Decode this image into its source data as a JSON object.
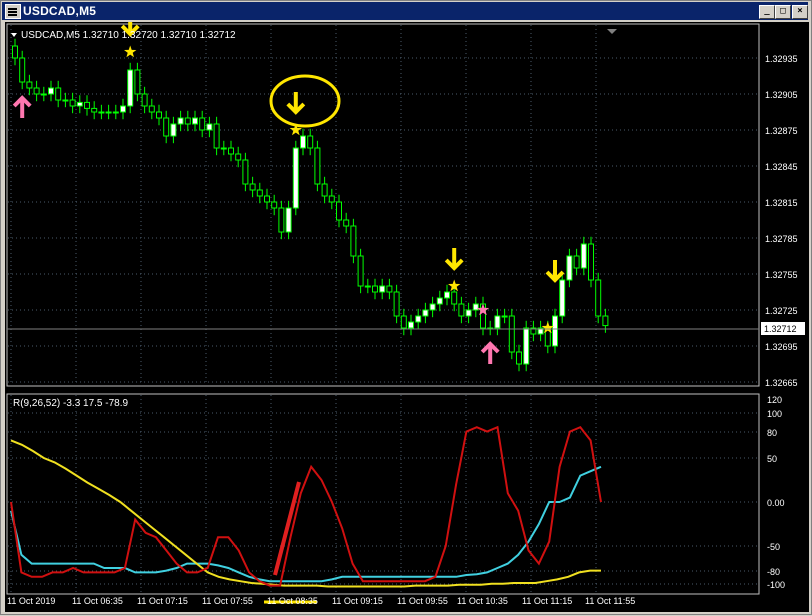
{
  "window": {
    "title": "USDCAD,M5",
    "buttons": {
      "minimize": "_",
      "maximize": "□",
      "close": "×"
    }
  },
  "main_panel": {
    "header": "USDCAD,M5  1.32710 1.32720 1.32710 1.32712",
    "price_axis": [
      "1.32935",
      "1.32905",
      "1.32875",
      "1.32845",
      "1.32815",
      "1.32785",
      "1.32755",
      "1.32725",
      "1.32695",
      "1.32665"
    ],
    "current_price": "1.32712"
  },
  "indicator_panel": {
    "header": "R(9,26,52) -3.3 17.5 -78.9",
    "axis": [
      "120",
      "100",
      "80",
      "50",
      "0.00",
      "-50",
      "-80",
      "-100"
    ]
  },
  "time_axis": [
    "11 Oct 2019",
    "11 Oct 06:35",
    "11 Oct 07:15",
    "11 Oct 07:55",
    "11 Oct 08:35",
    "11 Oct 09:15",
    "11 Oct 09:55",
    "11 Oct 10:35",
    "11 Oct 11:15",
    "11 Oct 11:55"
  ],
  "colors": {
    "background": "#000000",
    "candle": "#00ff00",
    "bull_body": "#ffffff",
    "grid": "#4a5a6a",
    "arrow_down": "#ffe600",
    "arrow_up": "#ff77b0",
    "star_yellow": "#ffe600",
    "star_pink": "#ff77b0",
    "fast_line": "#d01010",
    "mid_line": "#40d0e0",
    "slow_line": "#f0e020",
    "annotation": "#ffe600"
  },
  "chart_data": [
    {
      "type": "candlestick",
      "symbol": "USDCAD",
      "timeframe": "M5",
      "ylim": [
        1.3265,
        1.3295
      ],
      "closes": [
        1.32935,
        1.32915,
        1.3291,
        1.32905,
        1.32905,
        1.3291,
        1.329,
        1.329,
        1.32895,
        1.32898,
        1.32893,
        1.3289,
        1.3289,
        1.3289,
        1.3289,
        1.32895,
        1.32925,
        1.32905,
        1.32895,
        1.3289,
        1.32885,
        1.3287,
        1.3288,
        1.32885,
        1.3288,
        1.32885,
        1.32875,
        1.3288,
        1.3286,
        1.3286,
        1.32855,
        1.3285,
        1.3283,
        1.32825,
        1.3282,
        1.32815,
        1.3281,
        1.3279,
        1.3281,
        1.3286,
        1.3287,
        1.3286,
        1.3283,
        1.3282,
        1.32815,
        1.328,
        1.32795,
        1.3277,
        1.32745,
        1.32745,
        1.3274,
        1.32745,
        1.3274,
        1.3272,
        1.3271,
        1.32715,
        1.3272,
        1.32725,
        1.3273,
        1.32735,
        1.3274,
        1.3273,
        1.3272,
        1.32725,
        1.3273,
        1.3271,
        1.3271,
        1.3272,
        1.3272,
        1.3269,
        1.3268,
        1.3271,
        1.32705,
        1.3271,
        1.32695,
        1.3272,
        1.3275,
        1.3277,
        1.3276,
        1.3278,
        1.3275,
        1.3272,
        1.32712
      ],
      "markers": [
        {
          "kind": "arrow-down",
          "color": "yellow",
          "index": 16
        },
        {
          "kind": "star",
          "color": "yellow",
          "index": 16
        },
        {
          "kind": "arrow-up",
          "color": "pink",
          "index": 1
        },
        {
          "kind": "arrow-down",
          "color": "yellow",
          "index": 39
        },
        {
          "kind": "star",
          "color": "yellow",
          "index": 39
        },
        {
          "kind": "arrow-down",
          "color": "yellow",
          "index": 61
        },
        {
          "kind": "star",
          "color": "yellow",
          "index": 61
        },
        {
          "kind": "arrow-up",
          "color": "pink",
          "index": 66
        },
        {
          "kind": "star",
          "color": "pink",
          "index": 65
        },
        {
          "kind": "arrow-down",
          "color": "yellow",
          "index": 75
        },
        {
          "kind": "star",
          "color": "yellow",
          "index": 74
        }
      ]
    },
    {
      "type": "line",
      "indicator": "R(9,26,52)",
      "ylim": [
        -105,
        125
      ],
      "series": [
        {
          "name": "",
          "values": [
            -10,
            -60,
            -70,
            -70,
            -70,
            -70,
            -70,
            -70,
            -70,
            -75,
            -75,
            -75,
            -80,
            -80,
            -80,
            -78,
            -75,
            -70,
            -70,
            -70,
            -72,
            -75,
            -80,
            -85,
            -88,
            -90,
            -90,
            -90,
            -90,
            -90,
            -90,
            -88,
            -85,
            -85,
            -85,
            -85,
            -85,
            -85,
            -85,
            -85,
            -85,
            -85,
            -85,
            -85,
            -83,
            -82,
            -80,
            -75,
            -70,
            -60,
            -45,
            -25,
            0,
            0,
            5,
            30,
            35,
            40
          ],
          "color": "#40d0e0"
        },
        {
          "name": "",
          "values": [
            70,
            65,
            58,
            50,
            45,
            38,
            30,
            22,
            15,
            8,
            0,
            -10,
            -20,
            -30,
            -40,
            -50,
            -60,
            -70,
            -80,
            -85,
            -88,
            -90,
            -92,
            -93,
            -94,
            -95,
            -95,
            -95,
            -95,
            -96,
            -96,
            -96,
            -96,
            -96,
            -96,
            -96,
            -96,
            -95,
            -95,
            -95,
            -95,
            -94,
            -94,
            -94,
            -93,
            -93,
            -92,
            -92,
            -92,
            -90,
            -88,
            -85,
            -80,
            -78,
            -78
          ],
          "color": "#f0e020"
        },
        {
          "name": "",
          "values": [
            0,
            -80,
            -85,
            -85,
            -80,
            -80,
            -75,
            -80,
            -80,
            -80,
            -80,
            -75,
            -20,
            -35,
            -40,
            -55,
            -70,
            -80,
            -80,
            -75,
            -40,
            -40,
            -55,
            -80,
            -90,
            -95,
            -95,
            -40,
            10,
            40,
            25,
            0,
            -30,
            -70,
            -90,
            -90,
            -90,
            -90,
            -90,
            -90,
            -90,
            -85,
            -50,
            20,
            80,
            85,
            80,
            85,
            10,
            -10,
            -55,
            -70,
            -45,
            40,
            80,
            85,
            70,
            0
          ],
          "color": "#d01010"
        }
      ]
    }
  ]
}
